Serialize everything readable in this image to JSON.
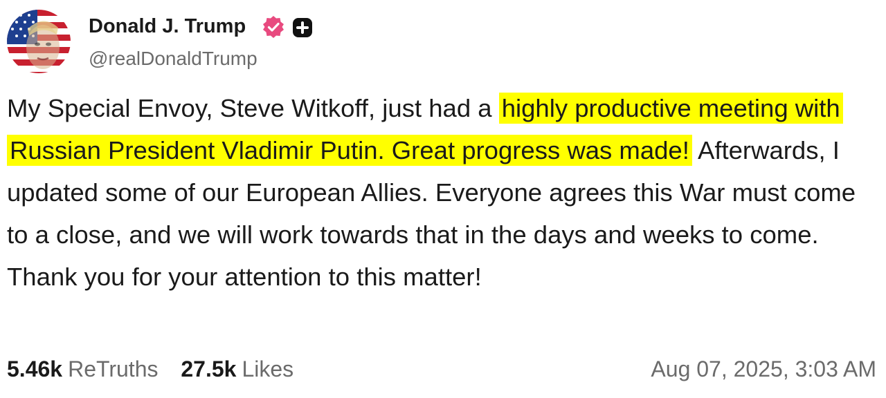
{
  "author": {
    "display_name": "Donald J. Trump",
    "handle": "@realDonaldTrump",
    "verified_badge_color": "#e84a7f",
    "avatar": "avatar-flag-portrait"
  },
  "post": {
    "segments": [
      {
        "text": "My Special Envoy, Steve Witkoff, just had a ",
        "highlighted": false
      },
      {
        "text": "highly productive meeting with Russian President Vladimir Putin. Great progress was made!",
        "highlighted": true
      },
      {
        "text": " Afterwards, I updated some of our European Allies. Everyone agrees this War must come to a close, and we will work towards that in the days and weeks to come. Thank you for your attention to this matter!",
        "highlighted": false
      }
    ],
    "highlight_color": "#ffff00"
  },
  "stats": {
    "retruths_count": "5.46k",
    "retruths_label": "ReTruths",
    "likes_count": "27.5k",
    "likes_label": "Likes"
  },
  "timestamp": "Aug 07, 2025, 3:03 AM"
}
